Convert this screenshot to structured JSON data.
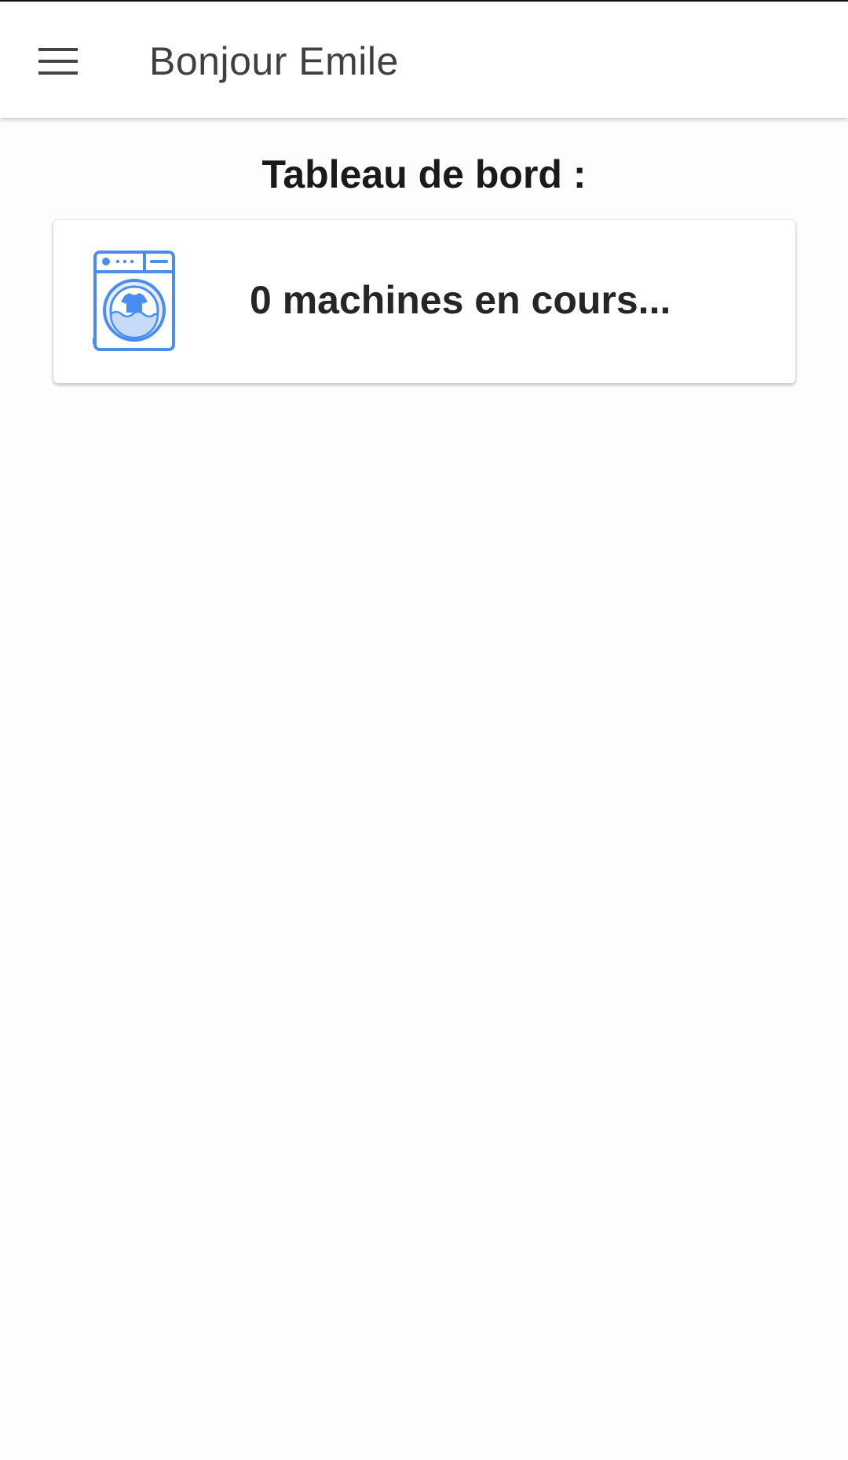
{
  "header": {
    "title": "Bonjour Emile",
    "menu_icon": "hamburger-menu-icon"
  },
  "dashboard": {
    "title": "Tableau de bord :",
    "machines_card": {
      "icon": "washing-machine-icon",
      "count": "0",
      "label": "machines en cours..."
    }
  },
  "colors": {
    "icon_blue": "#4a8df0",
    "icon_fill": "#e3edfc",
    "title_text": "#404040",
    "body_text": "#262626"
  }
}
